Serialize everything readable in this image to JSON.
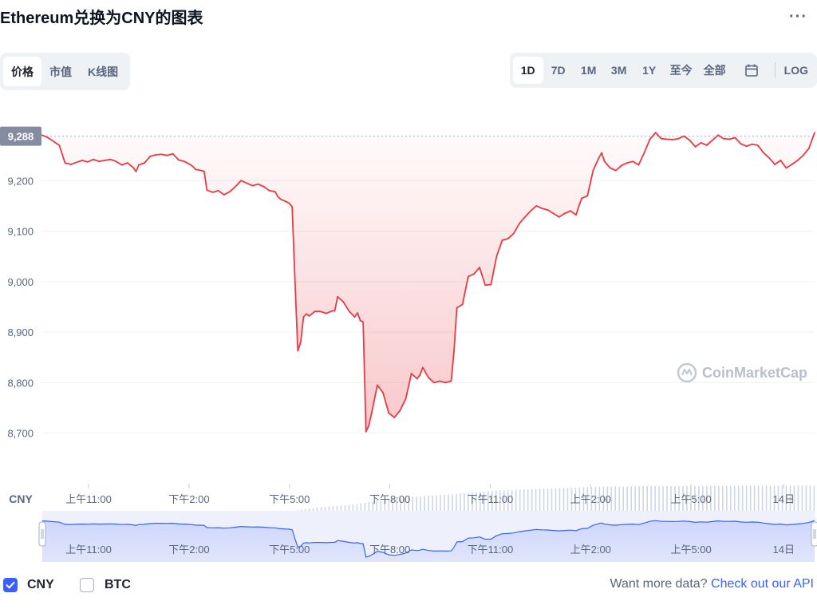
{
  "header": {
    "title": "Ethereum兑换为CNY的图表",
    "more": "···"
  },
  "tabs": [
    {
      "label": "价格",
      "active": true
    },
    {
      "label": "市值",
      "active": false
    },
    {
      "label": "K线图",
      "active": false
    }
  ],
  "ranges": [
    "1D",
    "7D",
    "1M",
    "3M",
    "1Y",
    "至今",
    "全部"
  ],
  "range_active": "1D",
  "log_label": "LOG",
  "currency_label": "CNY",
  "current_price_badge": "9,288",
  "watermark": "CoinMarketCap",
  "legend": [
    {
      "label": "CNY",
      "checked": true
    },
    {
      "label": "BTC",
      "checked": false
    }
  ],
  "api": {
    "text": "Want more data?",
    "link": "Check out our API"
  },
  "colors": {
    "down": "#ea3943",
    "up": "#16c784",
    "accent": "#3861fb",
    "volume": "#cfd6e4"
  },
  "chart_data": {
    "type": "area",
    "ylim": [
      8600,
      9330
    ],
    "yticks": [
      {
        "value": 9200,
        "label": "9,200"
      },
      {
        "value": 9100,
        "label": "9,100"
      },
      {
        "value": 9000,
        "label": "9,000"
      },
      {
        "value": 8900,
        "label": "8,900"
      },
      {
        "value": 8800,
        "label": "8,800"
      },
      {
        "value": 8700,
        "label": "8,700"
      }
    ],
    "reference_price": 9288,
    "xlim": [
      0,
      100
    ],
    "xticks": [
      {
        "x": 6,
        "label": "上午11:00"
      },
      {
        "x": 19,
        "label": "下午2:00"
      },
      {
        "x": 32,
        "label": "下午5:00"
      },
      {
        "x": 45,
        "label": "下午8:00"
      },
      {
        "x": 58,
        "label": "下午11:00"
      },
      {
        "x": 71,
        "label": "上午2:00"
      },
      {
        "x": 84,
        "label": "上午5:00"
      },
      {
        "x": 96,
        "label": "14日"
      }
    ],
    "series": [
      {
        "values": [
          [
            0,
            9290
          ],
          [
            1,
            9285
          ],
          [
            3,
            9270
          ],
          [
            4,
            9235
          ],
          [
            5,
            9232
          ],
          [
            7,
            9240
          ],
          [
            8,
            9237
          ],
          [
            9,
            9242
          ],
          [
            10,
            9238
          ],
          [
            11,
            9240
          ],
          [
            12,
            9242
          ],
          [
            13,
            9238
          ],
          [
            14,
            9231
          ],
          [
            15,
            9235
          ],
          [
            16,
            9226
          ],
          [
            16.5,
            9218
          ],
          [
            17,
            9231
          ],
          [
            18,
            9235
          ],
          [
            19,
            9248
          ],
          [
            20,
            9251
          ],
          [
            21,
            9252
          ],
          [
            22,
            9250
          ],
          [
            23,
            9253
          ],
          [
            24,
            9241
          ],
          [
            25,
            9238
          ],
          [
            26,
            9232
          ],
          [
            26.5,
            9228
          ],
          [
            27,
            9222
          ],
          [
            28,
            9220
          ],
          [
            28.5,
            9218
          ],
          [
            29,
            9181
          ],
          [
            30,
            9177
          ],
          [
            31,
            9180
          ],
          [
            32,
            9172
          ],
          [
            33,
            9178
          ],
          [
            34,
            9188
          ],
          [
            35,
            9200
          ],
          [
            36,
            9195
          ],
          [
            37,
            9190
          ],
          [
            38,
            9193
          ],
          [
            39,
            9188
          ],
          [
            40,
            9180
          ],
          [
            41,
            9178
          ],
          [
            41.5,
            9168
          ],
          [
            42,
            9163
          ],
          [
            43,
            9158
          ],
          [
            43.5,
            9155
          ],
          [
            44,
            9148
          ],
          [
            44.5,
            9000
          ],
          [
            45,
            8863
          ],
          [
            45.5,
            8880
          ],
          [
            46,
            8930
          ],
          [
            46.5,
            8936
          ],
          [
            47,
            8932
          ],
          [
            48,
            8941
          ],
          [
            49,
            8941
          ],
          [
            50,
            8937
          ],
          [
            51,
            8942
          ],
          [
            51.5,
            8942
          ],
          [
            52,
            8970
          ],
          [
            53,
            8960
          ],
          [
            54,
            8942
          ],
          [
            55,
            8930
          ],
          [
            55.5,
            8938
          ],
          [
            56,
            8923
          ],
          [
            56.5,
            8920
          ],
          [
            57,
            8703
          ],
          [
            57.5,
            8715
          ],
          [
            58,
            8740
          ],
          [
            59,
            8795
          ],
          [
            60,
            8780
          ],
          [
            61,
            8740
          ],
          [
            62,
            8731
          ],
          [
            63,
            8745
          ],
          [
            64,
            8768
          ],
          [
            65,
            8818
          ],
          [
            66,
            8808
          ],
          [
            66.5,
            8815
          ],
          [
            67,
            8830
          ],
          [
            68,
            8810
          ],
          [
            69,
            8800
          ],
          [
            70,
            8803
          ],
          [
            71,
            8800
          ],
          [
            72,
            8803
          ],
          [
            72.5,
            8862
          ],
          [
            73,
            8948
          ],
          [
            74,
            8955
          ],
          [
            75,
            9010
          ],
          [
            76,
            9015
          ],
          [
            77,
            9028
          ],
          [
            78,
            8993
          ],
          [
            79,
            8994
          ],
          [
            80,
            9050
          ],
          [
            81,
            9082
          ],
          [
            82,
            9085
          ],
          [
            83,
            9095
          ],
          [
            84,
            9115
          ],
          [
            85,
            9128
          ],
          [
            86,
            9140
          ],
          [
            87,
            9150
          ],
          [
            88,
            9145
          ],
          [
            89,
            9142
          ],
          [
            90,
            9135
          ],
          [
            91,
            9128
          ],
          [
            92,
            9135
          ],
          [
            93,
            9140
          ],
          [
            94,
            9132
          ],
          [
            94.5,
            9150
          ],
          [
            95,
            9165
          ],
          [
            96,
            9170
          ],
          [
            97,
            9220
          ],
          [
            98,
            9245
          ],
          [
            98.5,
            9255
          ],
          [
            99,
            9238
          ],
          [
            100,
            9225
          ],
          [
            101,
            9220
          ],
          [
            102,
            9230
          ],
          [
            103,
            9235
          ],
          [
            104,
            9238
          ],
          [
            105,
            9231
          ],
          [
            106,
            9255
          ],
          [
            107,
            9282
          ],
          [
            108,
            9295
          ],
          [
            109,
            9283
          ],
          [
            110,
            9282
          ],
          [
            111,
            9281
          ],
          [
            112,
            9283
          ],
          [
            113,
            9288
          ],
          [
            114,
            9280
          ],
          [
            115,
            9267
          ],
          [
            116,
            9275
          ],
          [
            117,
            9270
          ],
          [
            118,
            9280
          ],
          [
            119,
            9290
          ],
          [
            120,
            9283
          ],
          [
            121,
            9282
          ],
          [
            122,
            9285
          ],
          [
            123,
            9273
          ],
          [
            124,
            9268
          ],
          [
            125,
            9272
          ],
          [
            126,
            9270
          ],
          [
            127,
            9255
          ],
          [
            128,
            9245
          ],
          [
            129,
            9232
          ],
          [
            130,
            9240
          ],
          [
            131,
            9225
          ],
          [
            132,
            9232
          ],
          [
            133,
            9240
          ],
          [
            134,
            9250
          ],
          [
            135,
            9264
          ],
          [
            136,
            9295
          ]
        ]
      }
    ],
    "volume_note": "",
    "volume": [
      {
        "x": 0,
        "v": 0.46
      },
      {
        "x": 20,
        "v": 0.47
      },
      {
        "x": 40,
        "v": 0.49
      },
      {
        "x": 44,
        "v": 0.52
      },
      {
        "x": 46,
        "v": 0.56
      },
      {
        "x": 50,
        "v": 0.6
      },
      {
        "x": 55,
        "v": 0.64
      },
      {
        "x": 60,
        "v": 0.72
      },
      {
        "x": 65,
        "v": 0.77
      },
      {
        "x": 70,
        "v": 0.8
      },
      {
        "x": 75,
        "v": 0.84
      },
      {
        "x": 80,
        "v": 0.88
      },
      {
        "x": 90,
        "v": 0.92
      },
      {
        "x": 100,
        "v": 0.95
      },
      {
        "x": 110,
        "v": 0.96
      },
      {
        "x": 136,
        "v": 0.97
      }
    ]
  }
}
